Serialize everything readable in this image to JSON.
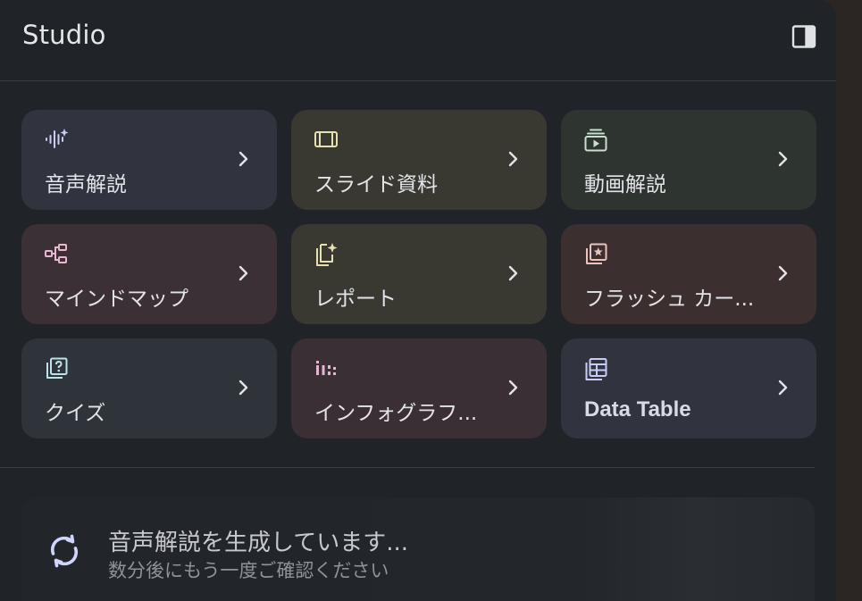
{
  "header": {
    "title": "Studio",
    "collapse_icon": "side-panel-icon"
  },
  "tiles": [
    {
      "label": "音声解説",
      "icon": "audio-spark-icon",
      "bg": "#31343f",
      "icon_color": "#c8cdf6"
    },
    {
      "label": "スライド資料",
      "icon": "slides-icon",
      "bg": "#393932",
      "icon_color": "#e5e1b0"
    },
    {
      "label": "動画解説",
      "icon": "video-overview-icon",
      "bg": "#2e3430",
      "icon_color": "#c7dfcb"
    },
    {
      "label": "マインドマップ",
      "icon": "mind-map-icon",
      "bg": "#3a3035",
      "icon_color": "#e7b6cf"
    },
    {
      "label": "レポート",
      "icon": "report-icon",
      "bg": "#393932",
      "icon_color": "#e5e1b0"
    },
    {
      "label": "フラッシュ カー...",
      "icon": "flashcards-icon",
      "bg": "#3b302f",
      "icon_color": "#ebc3bd"
    },
    {
      "label": "クイズ",
      "icon": "quiz-icon",
      "bg": "#2f343a",
      "icon_color": "#bfe1ea"
    },
    {
      "label": "インフォグラフ...",
      "icon": "infographic-icon",
      "bg": "#3b2f36",
      "icon_color": "#e6b4cf"
    },
    {
      "label": "Data Table",
      "icon": "data-table-icon",
      "bg": "#31343f",
      "icon_color": "#c8cdf6"
    }
  ],
  "status": {
    "icon": "sync-icon",
    "title": "音声解説を生成しています...",
    "subtitle": "数分後にもう一度ご確認ください"
  }
}
